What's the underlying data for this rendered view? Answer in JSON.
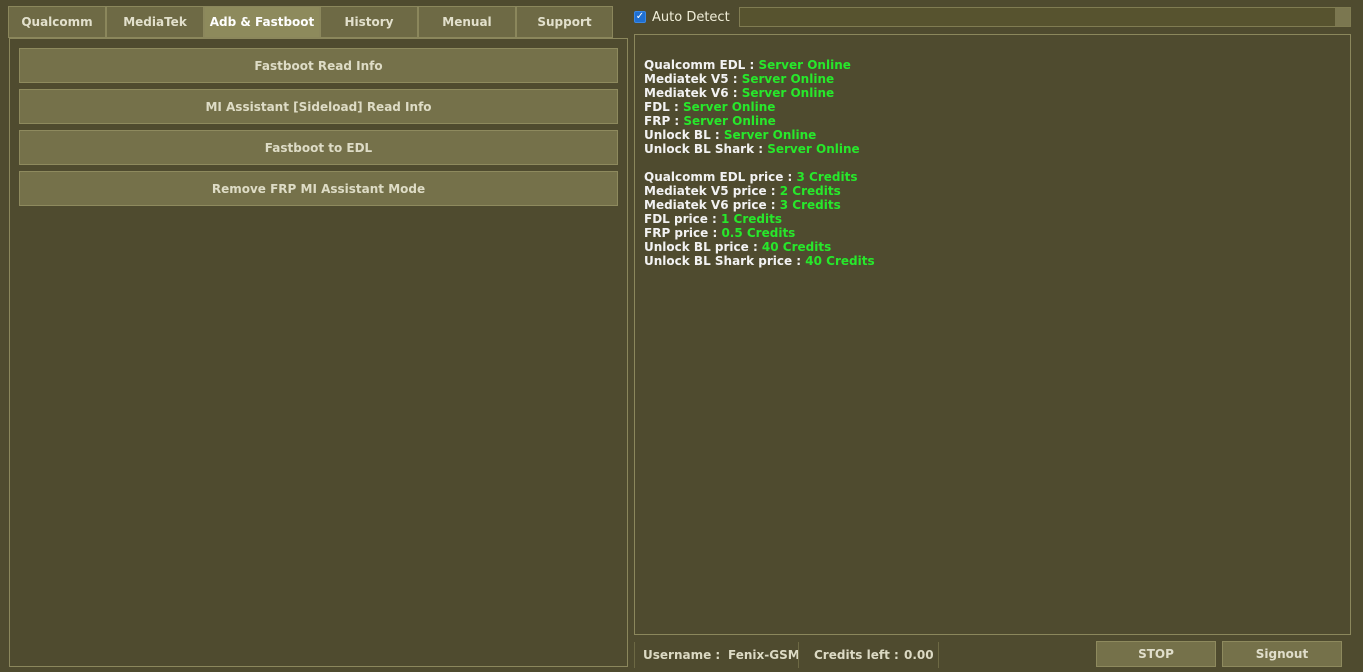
{
  "tabs": [
    {
      "label": "Qualcomm"
    },
    {
      "label": "MediaTek"
    },
    {
      "label": "Adb & Fastboot",
      "active": true
    },
    {
      "label": "History"
    },
    {
      "label": "Menual"
    },
    {
      "label": "Support"
    }
  ],
  "actions": [
    {
      "label": "Fastboot Read Info"
    },
    {
      "label": "MI Assistant [Sideload] Read Info"
    },
    {
      "label": "Fastboot to EDL"
    },
    {
      "label": "Remove FRP MI Assistant Mode"
    }
  ],
  "auto_detect": {
    "label": "Auto Detect",
    "checked": true
  },
  "log": {
    "servers": [
      {
        "key": "Qualcomm EDL : ",
        "value": "Server Online"
      },
      {
        "key": "Mediatek V5 : ",
        "value": "Server Online"
      },
      {
        "key": "Mediatek V6 : ",
        "value": "Server Online"
      },
      {
        "key": "FDL : ",
        "value": "Server Online"
      },
      {
        "key": "FRP : ",
        "value": "Server Online"
      },
      {
        "key": "Unlock BL : ",
        "value": "Server Online"
      },
      {
        "key": "Unlock BL Shark : ",
        "value": "Server Online"
      }
    ],
    "prices": [
      {
        "key": "Qualcomm EDL price : ",
        "value": "3 Credits"
      },
      {
        "key": "Mediatek V5 price : ",
        "value": "2 Credits"
      },
      {
        "key": "Mediatek V6 price : ",
        "value": "3 Credits"
      },
      {
        "key": "FDL price : ",
        "value": "1 Credits"
      },
      {
        "key": "FRP price : ",
        "value": "0.5 Credits"
      },
      {
        "key": "Unlock BL price : ",
        "value": "40 Credits"
      },
      {
        "key": "Unlock BL Shark price : ",
        "value": "40 Credits"
      }
    ],
    "value_color": "#27e82b"
  },
  "status": {
    "username_label": "Username :",
    "username": "Fenix-GSM",
    "credits_label": "Credits left :",
    "credits": "0.00"
  },
  "buttons": {
    "stop": "STOP",
    "signout": "Signout"
  }
}
